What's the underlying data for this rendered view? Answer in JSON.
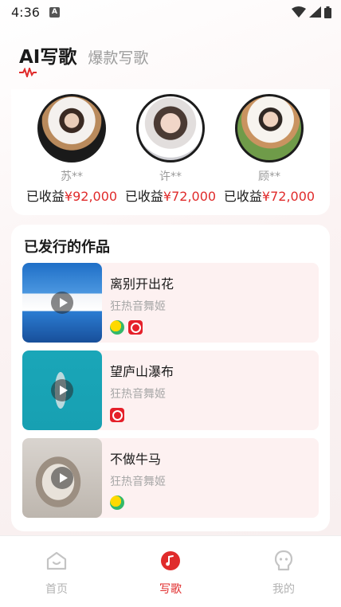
{
  "status_bar": {
    "time": "4:36",
    "notification_letter": "A"
  },
  "header": {
    "tabs": [
      {
        "label": "AI写歌",
        "active": true
      },
      {
        "label": "爆款写歌",
        "active": false
      }
    ]
  },
  "earners": [
    {
      "name": "苏**",
      "income_prefix": "已收益",
      "amount": "¥92,000"
    },
    {
      "name": "许**",
      "income_prefix": "已收益",
      "amount": "¥72,000"
    },
    {
      "name": "顾**",
      "income_prefix": "已收益",
      "amount": "¥72,000"
    }
  ],
  "releases": {
    "title": "已发行的作品",
    "songs": [
      {
        "title": "离别开出花",
        "artist": "狂热音舞姬",
        "platforms": [
          "qq-music-icon",
          "netease-music-icon"
        ]
      },
      {
        "title": "望庐山瀑布",
        "artist": "狂热音舞姬",
        "platforms": [
          "netease-music-icon"
        ]
      },
      {
        "title": "不做牛马",
        "artist": "狂热音舞姬",
        "platforms": [
          "qq-music-icon"
        ]
      }
    ]
  },
  "bottom_nav": [
    {
      "label": "首页",
      "icon": "home-icon",
      "active": false
    },
    {
      "label": "写歌",
      "icon": "music-note-icon",
      "active": true
    },
    {
      "label": "我的",
      "icon": "profile-icon",
      "active": false
    }
  ],
  "colors": {
    "accent": "#e02b2b",
    "song_row_bg": "#fdf1f1"
  }
}
